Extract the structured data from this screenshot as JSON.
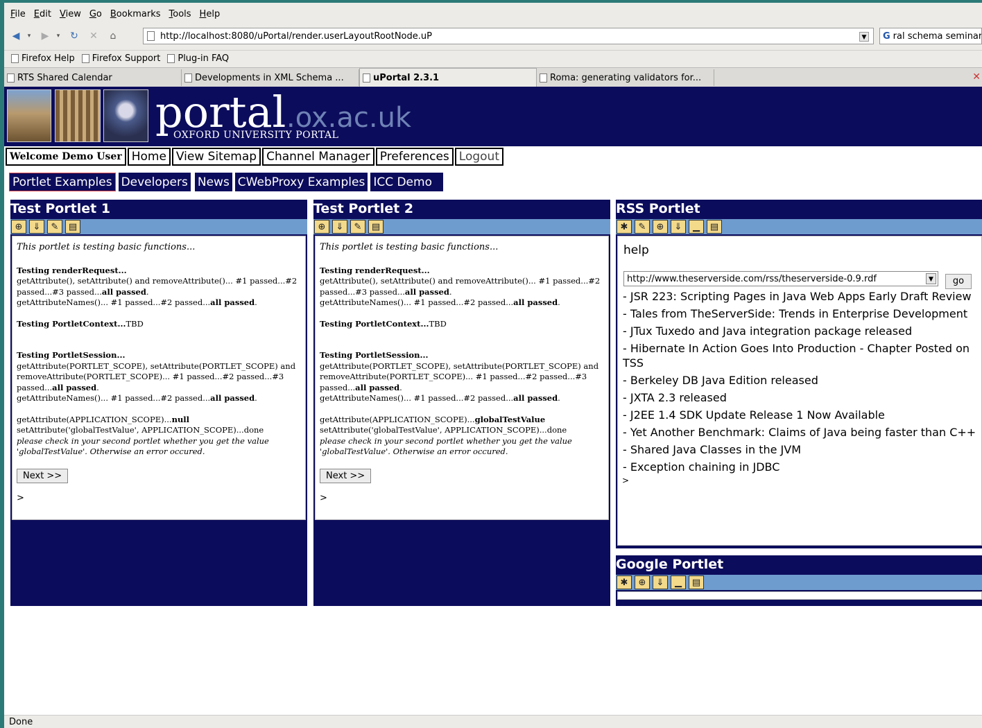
{
  "browser": {
    "menu": [
      "File",
      "Edit",
      "View",
      "Go",
      "Bookmarks",
      "Tools",
      "Help"
    ],
    "url": "http://localhost:8080/uPortal/render.userLayoutRootNode.uP",
    "search_text": "ral schema seminar",
    "bookmarks": [
      "Firefox Help",
      "Firefox Support",
      "Plug-in FAQ"
    ],
    "tabs": [
      "RTS Shared Calendar",
      "Developments in XML Schema ...",
      "uPortal 2.3.1",
      "Roma: generating validators for..."
    ],
    "active_tab": 2,
    "status": "Done"
  },
  "banner": {
    "logo_main": "portal",
    "logo_domain": ".ox.ac.uk",
    "logo_sub": "OXFORD UNIVERSITY PORTAL"
  },
  "topnav": {
    "welcome": "Welcome Demo User",
    "items": [
      "Home",
      "View Sitemap",
      "Channel Manager",
      "Preferences",
      "Logout"
    ]
  },
  "channel_tabs": [
    "Portlet Examples",
    "Developers",
    "News",
    "CWebProxy Examples",
    "ICC Demo"
  ],
  "test_portlet": {
    "titles": [
      "Test Portlet 1",
      "Test Portlet 2"
    ],
    "intro": "This portlet is testing basic functions...",
    "render_heading": "Testing renderRequest...",
    "render_line1": "getAttribute(), setAttribute() and removeAttribute()... #1 passed...#2 passed...#3 passed...",
    "all_passed": "all passed",
    "render_line2": "getAttributeNames()... #1 passed...#2 passed...",
    "context_heading": "Testing PortletContext...",
    "context_value": "TBD",
    "session_heading": "Testing PortletSession...",
    "session_line1": "getAttribute(PORTLET_SCOPE), setAttribute(PORTLET_SCOPE) and removeAttribute(PORTLET_SCOPE)... #1 passed...#2 passed...#3 passed...",
    "session_line2": "getAttributeNames()... #1 passed...#2 passed...",
    "app_get_label": "getAttribute(APPLICATION_SCOPE)...",
    "app_get_values": [
      "null",
      "globalTestValue"
    ],
    "app_set_line": "setAttribute('globalTestValue', APPLICATION_SCOPE)...done",
    "app_note": "please check in your second portlet whether you get the value 'globalTestValue'. Otherwise an error occured.",
    "next_label": "Next >>",
    "gt": ">"
  },
  "rss_portlet": {
    "title": "RSS Portlet",
    "help": "help",
    "feed_url": "http://www.theserverside.com/rss/theserverside-0.9.rdf",
    "go_label": "go",
    "items": [
      "- JSR 223: Scripting Pages in Java Web Apps Early Draft Review",
      "- Tales from TheServerSide: Trends in Enterprise Development",
      "- JTux Tuxedo and Java integration package released",
      "- Hibernate In Action Goes Into Production - Chapter Posted on TSS",
      "- Berkeley DB Java Edition released",
      "- JXTA 2.3 released",
      "- J2EE 1.4 SDK Update Release 1 Now Available",
      "- Yet Another Benchmark: Claims of Java being faster than C++",
      "- Shared Java Classes in the JVM",
      "- Exception chaining in JDBC"
    ],
    "gt": ">"
  },
  "google_portlet": {
    "title": "Google Portlet"
  },
  "colors": {
    "portal_navy": "#0c0c5c",
    "control_bar": "#6f9ccf",
    "desktop_teal": "#2c7a77"
  },
  "icons": [
    "back-icon",
    "forward-icon",
    "reload-icon",
    "stop-icon",
    "home-icon",
    "page-icon",
    "maximize-icon",
    "detach-icon",
    "edit-icon",
    "minimize-icon",
    "remove-icon",
    "help-icon"
  ]
}
